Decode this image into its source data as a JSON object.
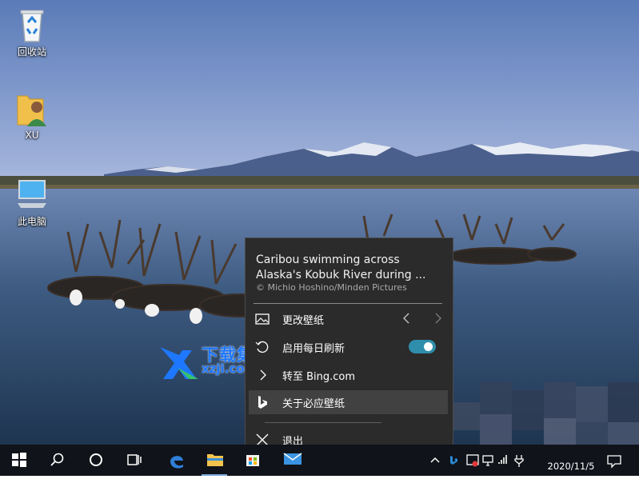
{
  "desktop": {
    "icons": [
      {
        "label": "回收站",
        "icon": "recycle-bin-icon"
      },
      {
        "label": "XU",
        "icon": "user-folder-icon"
      },
      {
        "label": "此电脑",
        "icon": "this-pc-icon"
      }
    ]
  },
  "watermark": {
    "title": "下载集",
    "url": "xzji.com"
  },
  "popup": {
    "caption_line1": "Caribou swimming across",
    "caption_line2": "Alaska's Kobuk River during ...",
    "credit": "© Michio Hoshino/Minden Pictures",
    "items": [
      {
        "label": "更改壁纸",
        "icon": "picture-icon"
      },
      {
        "label": "启用每日刷新",
        "icon": "refresh-icon",
        "toggle_on": true
      },
      {
        "label": "转至 Bing.com",
        "icon": "arrow-right-icon"
      },
      {
        "label": "关于必应壁纸",
        "icon": "bing-logo-icon"
      },
      {
        "label": "退出",
        "icon": "close-icon"
      }
    ],
    "toggle_color": "#2f8eac"
  },
  "taskbar": {
    "apps": [
      "start-icon",
      "search-icon",
      "cortana-icon",
      "task-view-icon",
      "edge-icon",
      "file-explorer-icon",
      "store-icon",
      "mail-icon"
    ],
    "clock_date": "2020/11/5"
  }
}
